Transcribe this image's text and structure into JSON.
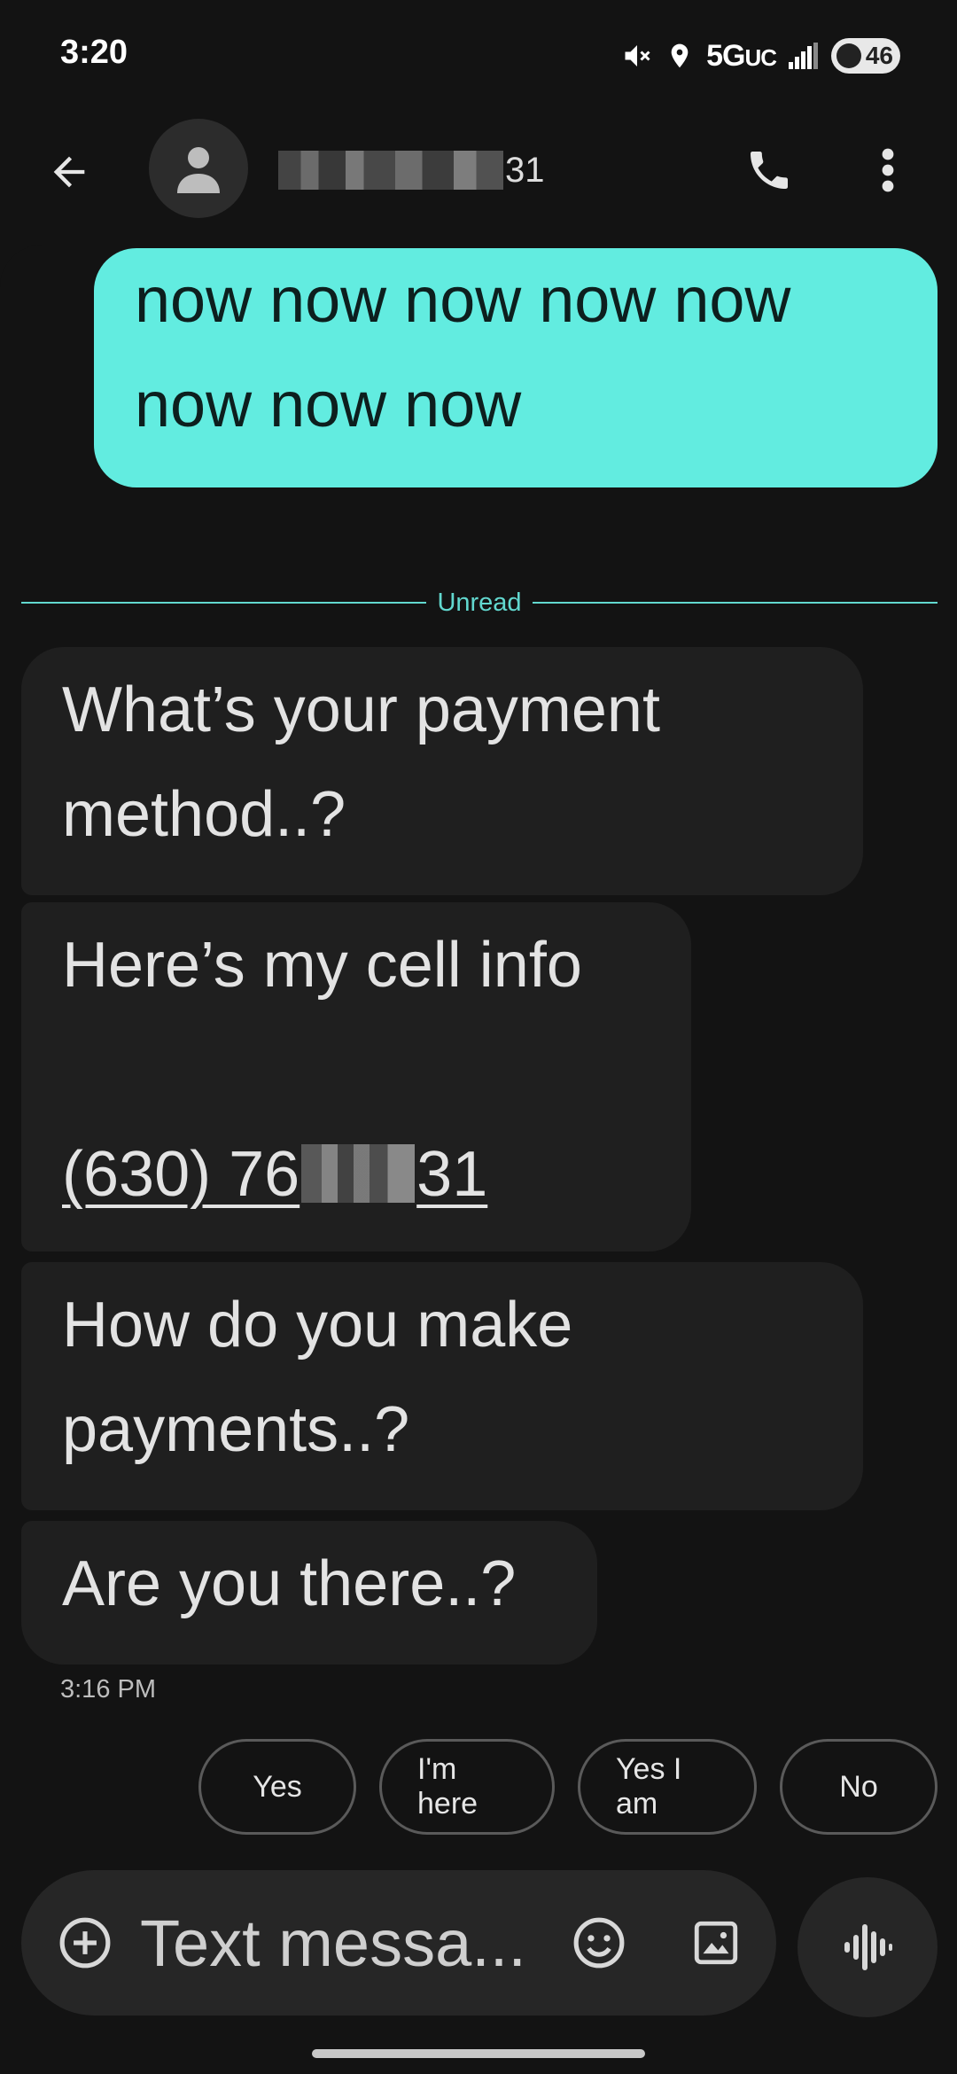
{
  "status_bar": {
    "time": "3:20",
    "network_main": "5G",
    "network_sub": "UC",
    "battery": "46",
    "icons": [
      "mute-icon",
      "location-icon",
      "signal-icon",
      "battery-saver-icon"
    ]
  },
  "app_bar": {
    "contact_visible_suffix": "31",
    "icons": [
      "back-arrow-icon",
      "person-icon",
      "phone-icon",
      "more-vert-icon"
    ]
  },
  "conversation": {
    "outgoing": [
      {
        "line1": "now now now now now",
        "line2": "now now now"
      }
    ],
    "unread_label": "Unread",
    "incoming": [
      {
        "line1": "What’s your payment",
        "line2": "method..?"
      },
      {
        "line1": "Here’s my cell info",
        "phone_start": "(630) 76",
        "phone_end": "31"
      },
      {
        "line1": "How do you make",
        "line2": "payments..?"
      },
      {
        "line1": "Are you there..?"
      }
    ],
    "timestamp": "3:16 PM"
  },
  "smart_replies": [
    "Yes",
    "I'm here",
    "Yes I am",
    "No"
  ],
  "composer": {
    "placeholder": "Text messa...",
    "icons": [
      "add-circle-icon",
      "emoji-icon",
      "gallery-icon",
      "voice-wave-icon"
    ]
  },
  "colors": {
    "background": "#131313",
    "outgoing_bubble": "#62ece0",
    "incoming_bubble": "#1f1f1f",
    "accent": "#62d8cf"
  }
}
